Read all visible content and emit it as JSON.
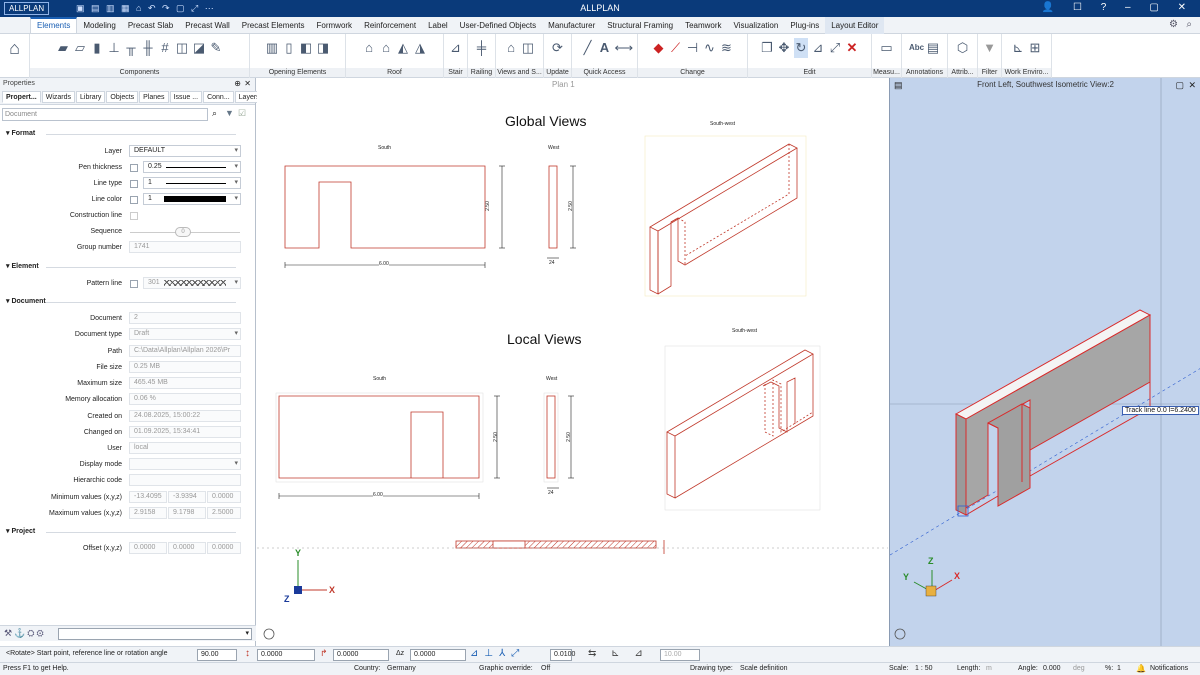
{
  "app": {
    "logo": "ALLPLAN",
    "title": "ALLPLAN"
  },
  "tabs": [
    "Elements",
    "Modeling",
    "Precast Slab",
    "Precast Wall",
    "Precast Elements",
    "Formwork",
    "Reinforcement",
    "Label",
    "User-Defined Objects",
    "Manufacturer",
    "Structural Framing",
    "Teamwork",
    "Visualization",
    "Plug-ins",
    "Layout Editor"
  ],
  "ribbon_groups": [
    "Components",
    "Opening Elements",
    "Roof",
    "Stair",
    "Railing",
    "Views and S...",
    "Update",
    "Quick Access",
    "Change",
    "Edit",
    "Measu...",
    "Annotations",
    "Attrib...",
    "Filter",
    "Work Enviro..."
  ],
  "props": {
    "header": "Properties",
    "tabs": [
      "Propert...",
      "Wizards",
      "Library",
      "Objects",
      "Planes",
      "Issue ...",
      "Conn...",
      "Layers"
    ],
    "search_placeholder": "Document",
    "format": {
      "title": "Format",
      "layer_label": "Layer",
      "layer": "DEFAULT",
      "pen_label": "Pen thickness",
      "pen": "0.25",
      "linetype_label": "Line type",
      "linetype": "1",
      "linecolor_label": "Line color",
      "linecolor": "1",
      "construction_label": "Construction line",
      "sequence_label": "Sequence",
      "sequence": "0",
      "group_label": "Group number",
      "group": "1741"
    },
    "element": {
      "title": "Element",
      "pattern_label": "Pattern line",
      "pattern": "301"
    },
    "document": {
      "title": "Document",
      "doc_label": "Document",
      "doc": "2",
      "type_label": "Document type",
      "type": "Draft",
      "path_label": "Path",
      "path": "C:\\Data\\Allplan\\Allplan 2026\\Pr",
      "size_label": "File size",
      "size": "0.25 MB",
      "max_label": "Maximum size",
      "max": "465.45 MB",
      "mem_label": "Memory allocation",
      "mem": "0.06 %",
      "created_label": "Created on",
      "created": "24.08.2025, 15:00:22",
      "changed_label": "Changed on",
      "changed": "01.09.2025, 15:34:41",
      "user_label": "User",
      "user": "local",
      "display_label": "Display mode",
      "display": "",
      "hier_label": "Hierarchic code",
      "hier": "",
      "min_label": "Minimum values (x,y,z)",
      "min": [
        "-13.4095",
        "-3.9394",
        "0.0000"
      ],
      "maxv_label": "Maximum values (x,y,z)",
      "maxv": [
        "2.9158",
        "9.1798",
        "2.5000"
      ]
    },
    "project": {
      "title": "Project",
      "offset_label": "Offset (x,y,z)",
      "offset": [
        "0.0000",
        "0.0000",
        "0.0000"
      ]
    }
  },
  "canvas": {
    "plan_tab": "Plan 1",
    "global_title": "Global Views",
    "local_title": "Local Views",
    "south": "South",
    "west": "West",
    "southwest": "South-west",
    "dim_600": "6.00",
    "dim_250": "2.50",
    "dim_24": "24",
    "axis_x": "X",
    "axis_y": "Y",
    "axis_z": "Z"
  },
  "iso": {
    "title": "Front Left, Southwest Isometric View:2",
    "track": "Track line 0.0  l=6.2400",
    "axis_x": "X",
    "axis_y": "Y",
    "axis_z": "Z"
  },
  "cmd": {
    "prompt": "<Rotate> Start point, reference line or rotation angle",
    "angle": "90.00",
    "v1": "0.0000",
    "v2": "0.0000",
    "dz_label": "Δz",
    "v3": "0.0000",
    "v4": "0.0100",
    "v5": "10.00"
  },
  "status": {
    "help": "Press F1 to get Help.",
    "country_label": "Country:",
    "country": "Germany",
    "graphic_label": "Graphic override:",
    "graphic": "Off",
    "drawing_label": "Drawing type:",
    "drawing": "Scale definition",
    "scale_label": "Scale:",
    "scale": "1 : 50",
    "length_label": "Length:",
    "length": "m",
    "angle_label": "Angle:",
    "angle": "0.000",
    "angle_unit": "deg",
    "pct_label": "%:",
    "pct": "1",
    "notifications": "Notifications"
  }
}
